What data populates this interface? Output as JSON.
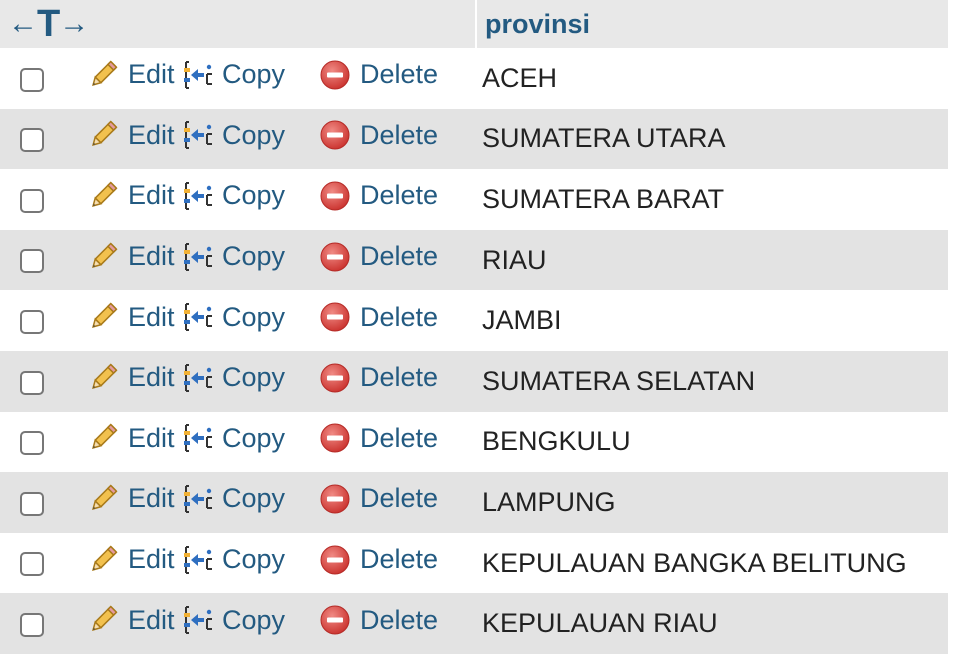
{
  "header": {
    "arrows": {
      "left": "←",
      "tee": "T",
      "right": "→"
    },
    "column": "provinsi"
  },
  "actions": {
    "edit": "Edit",
    "copy": "Copy",
    "delete": "Delete"
  },
  "icons": {
    "edit": "pencil-icon",
    "copy": "copy-icon",
    "delete": "delete-icon"
  },
  "colors": {
    "link": "#235a81",
    "row_alt": "#e3e3e3",
    "header_bg": "#e8e8e8",
    "delete_red": "#d9534f"
  },
  "rows": [
    {
      "checked": false,
      "provinsi": "ACEH"
    },
    {
      "checked": false,
      "provinsi": "SUMATERA UTARA"
    },
    {
      "checked": false,
      "provinsi": "SUMATERA BARAT"
    },
    {
      "checked": false,
      "provinsi": "RIAU"
    },
    {
      "checked": false,
      "provinsi": "JAMBI"
    },
    {
      "checked": false,
      "provinsi": "SUMATERA SELATAN"
    },
    {
      "checked": false,
      "provinsi": "BENGKULU"
    },
    {
      "checked": false,
      "provinsi": "LAMPUNG"
    },
    {
      "checked": false,
      "provinsi": "KEPULAUAN BANGKA BELITUNG"
    },
    {
      "checked": false,
      "provinsi": "KEPULAUAN RIAU"
    }
  ]
}
